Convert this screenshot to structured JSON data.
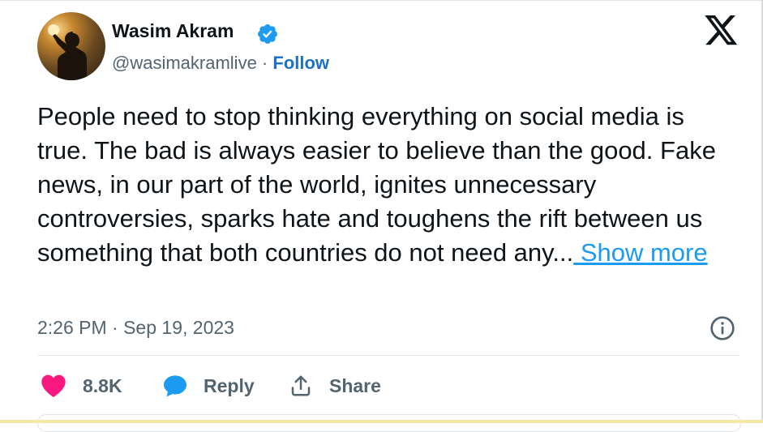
{
  "author": {
    "name": "Wasim Akram",
    "handle": "@wasimakramlive",
    "separator": " · ",
    "follow_label": "Follow"
  },
  "tweet": {
    "text": "People need to stop thinking everything on social media is true. The bad is always easier to believe than the good. Fake news, in our part of the world, ignites unnecessary controversies, sparks hate and toughens the rift between us something that both countries do not need any...",
    "show_more_label": " Show more",
    "timestamp": "2:26 PM · Sep 19, 2023"
  },
  "actions": {
    "likes_count": "8.8K",
    "reply_label": "Reply",
    "share_label": "Share"
  },
  "icons": {
    "verified": "verified-badge-icon",
    "brand": "x-logo-icon",
    "info": "info-icon",
    "like": "heart-icon",
    "reply": "speech-bubble-icon",
    "share": "share-upload-icon"
  },
  "colors": {
    "verified_blue": "#1d9bf0",
    "link_blue": "#1d9bf0",
    "follow_blue": "#1d72c8",
    "heart_pink": "#f91880",
    "text_primary": "#0f1419",
    "text_secondary": "#536471"
  }
}
